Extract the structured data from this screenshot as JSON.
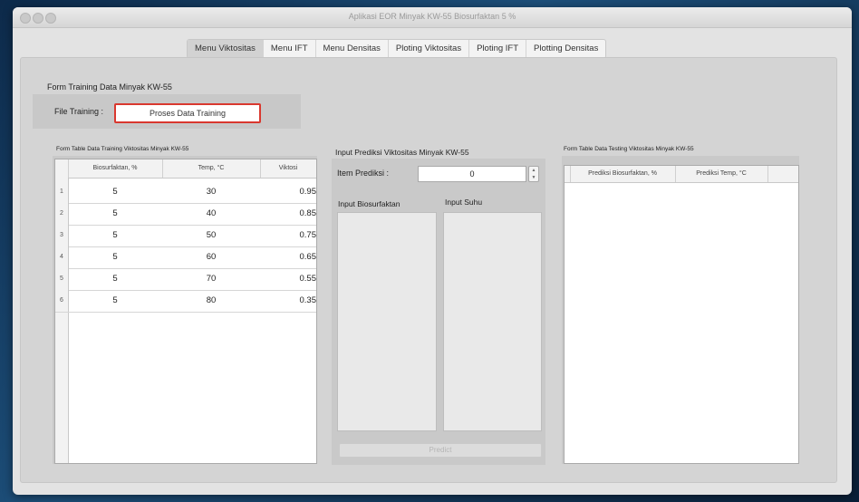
{
  "window": {
    "title": "Aplikasi EOR Minyak KW-55 Biosurfaktan 5 %"
  },
  "tabs": [
    {
      "label": "Menu Viktositas",
      "active": true
    },
    {
      "label": "Menu IFT",
      "active": false
    },
    {
      "label": "Menu Densitas",
      "active": false
    },
    {
      "label": "Ploting Viktositas",
      "active": false
    },
    {
      "label": "Ploting IFT",
      "active": false
    },
    {
      "label": "Plotting Densitas",
      "active": false
    }
  ],
  "training_form": {
    "title": "Form Training Data Minyak KW-55",
    "file_label": "File Training   :",
    "process_button": "Proses Data Training"
  },
  "training_table": {
    "title": "Form Table Data Training Viktositas Minyak KW-55",
    "headers": [
      "Biosurfaktan, %",
      "Temp, °C",
      "Viktosi"
    ],
    "rows": [
      {
        "num": "1",
        "bio": "5",
        "temp": "30",
        "visc": "0.95"
      },
      {
        "num": "2",
        "bio": "5",
        "temp": "40",
        "visc": "0.85"
      },
      {
        "num": "3",
        "bio": "5",
        "temp": "50",
        "visc": "0.75"
      },
      {
        "num": "4",
        "bio": "5",
        "temp": "60",
        "visc": "0.65"
      },
      {
        "num": "5",
        "bio": "5",
        "temp": "70",
        "visc": "0.55"
      },
      {
        "num": "6",
        "bio": "5",
        "temp": "80",
        "visc": "0.35"
      }
    ]
  },
  "prediction": {
    "title": "Input Prediksi Viktositas Minyak KW-55",
    "item_label": "Item Prediksi :",
    "item_value": "0",
    "input_bio_label": "Input Biosurfaktan",
    "input_suhu_label": "Input Suhu",
    "predict_button": "Predict"
  },
  "testing_table": {
    "title": "Form Table Data Testing Viktositas Minyak KW-55",
    "headers": [
      "Prediksi Biosurfaktan, %",
      "Prediksi Temp, °C"
    ]
  },
  "colors": {
    "highlight_border": "#d9382f",
    "window_bg": "#e3e3e3"
  }
}
